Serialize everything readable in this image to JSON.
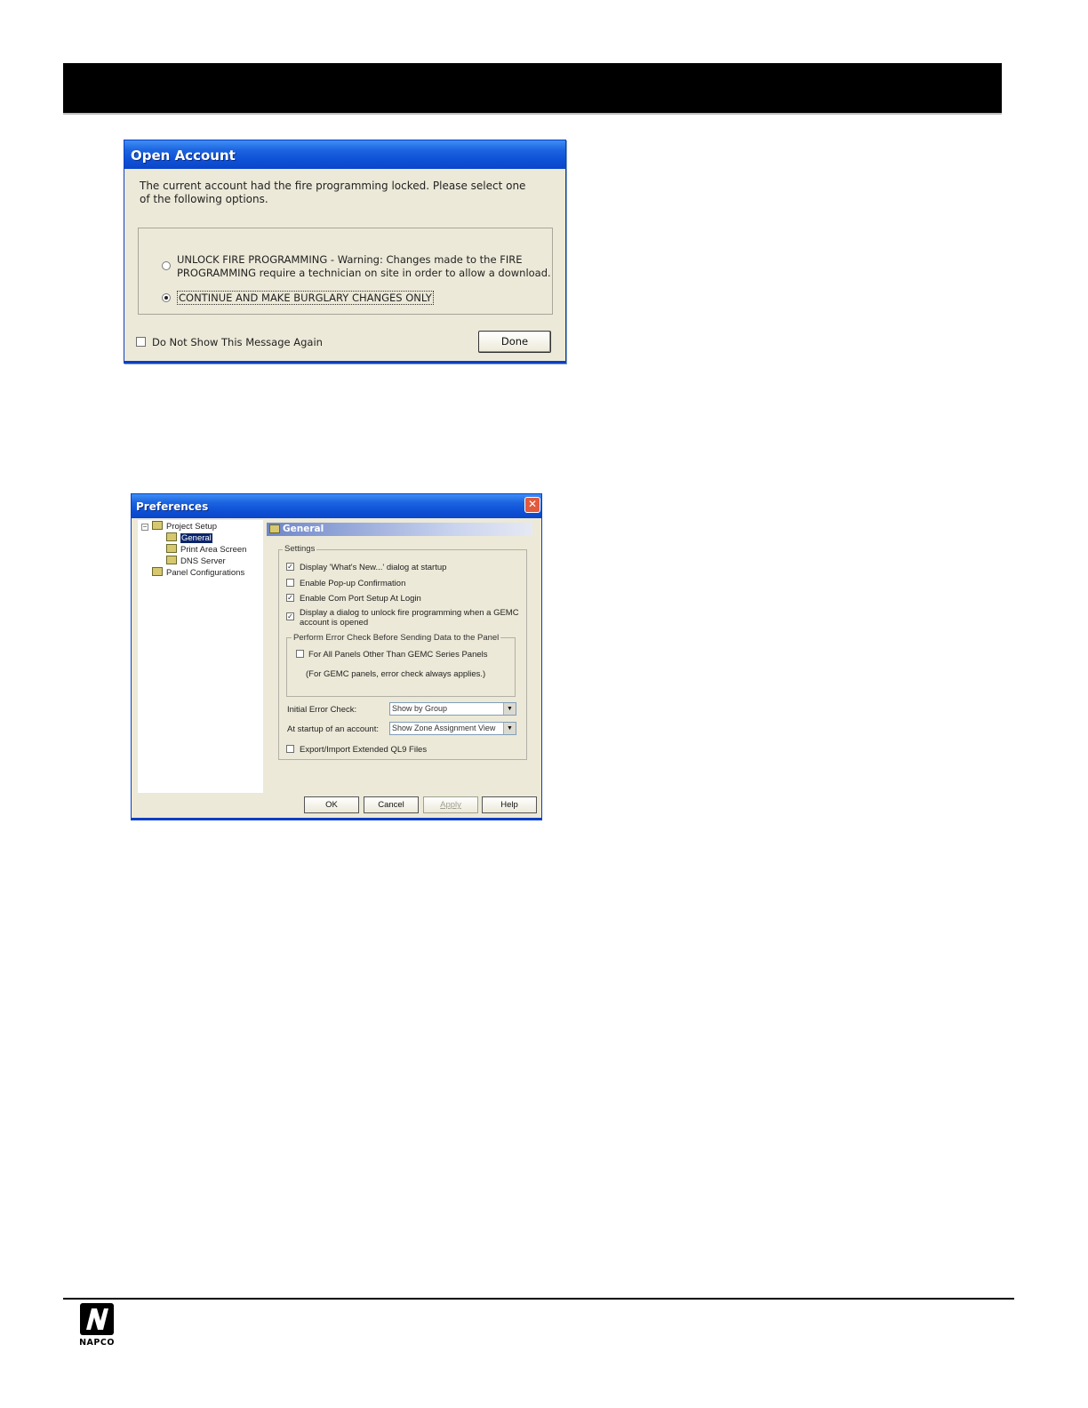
{
  "open_account": {
    "title": "Open Account",
    "message": "The current account had the fire programming locked.  Please select one of the following options.",
    "option_unlock_line1": "UNLOCK FIRE PROGRAMMING - Warning: Changes made to the FIRE",
    "option_unlock_line2": "PROGRAMMING require a technician on site in order to allow a download.",
    "option_continue": "CONTINUE AND MAKE BURGLARY CHANGES ONLY",
    "selected_option": "continue",
    "dont_show_label": "Do Not Show This Message Again",
    "dont_show_checked": false,
    "done_label": "Done"
  },
  "preferences": {
    "title": "Preferences",
    "close_symbol": "✕",
    "tree": {
      "root": "Project Setup",
      "children": [
        "General",
        "Print Area Screen",
        "DNS Server"
      ],
      "selected": "General",
      "sibling": "Panel Configurations"
    },
    "panel_title": "General",
    "settings_legend": "Settings",
    "checks": [
      {
        "label": "Display 'What's New...' dialog at startup",
        "checked": true
      },
      {
        "label": "Enable Pop-up Confirmation",
        "checked": false
      },
      {
        "label": "Enable Com Port Setup At Login",
        "checked": true
      },
      {
        "label_line1": "Display a dialog to unlock fire programming when a GEMC",
        "label_line2": "account is opened",
        "checked": true
      }
    ],
    "error_check_legend": "Perform Error Check Before Sending Data to the Panel",
    "error_check_option": "For All Panels Other Than GEMC Series Panels",
    "error_check_note": "(For GEMC panels, error check always applies.)",
    "initial_error_label": "Initial Error Check:",
    "initial_error_value": "Show by Group",
    "startup_label": "At startup of an account:",
    "startup_value": "Show Zone Assignment View",
    "export_label": "Export/Import Extended QL9 Files",
    "export_checked": false,
    "buttons": {
      "ok": "OK",
      "cancel": "Cancel",
      "apply": "Apply",
      "help": "Help"
    }
  },
  "footer": {
    "brand": "NAPCO"
  },
  "icons": {
    "check_mark": "✓",
    "dropdown_arrow": "▼",
    "tree_expand": "−"
  }
}
